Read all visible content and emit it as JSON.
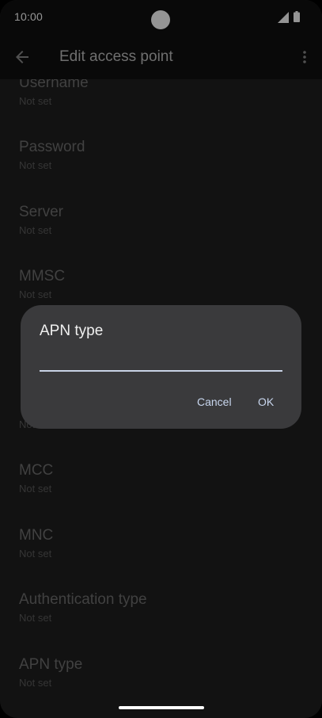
{
  "status_bar": {
    "time": "10:00",
    "icons": [
      "signal-icon",
      "battery-icon"
    ]
  },
  "app_bar": {
    "title": "Edit access point",
    "icons": [
      "back-arrow-icon",
      "overflow-menu-icon"
    ]
  },
  "preferences": [
    {
      "title": "Username",
      "summary": "Not set"
    },
    {
      "title": "Password",
      "summary": "Not set"
    },
    {
      "title": "Server",
      "summary": "Not set"
    },
    {
      "title": "MMSC",
      "summary": "Not set"
    },
    {
      "title": "",
      "summary": ""
    },
    {
      "title": "",
      "summary": "Not set"
    },
    {
      "title": "MCC",
      "summary": "Not set"
    },
    {
      "title": "MNC",
      "summary": "Not set"
    },
    {
      "title": "Authentication type",
      "summary": "Not set"
    },
    {
      "title": "APN type",
      "summary": "Not set"
    }
  ],
  "dialog": {
    "title": "APN type",
    "input_value": "",
    "cancel_label": "Cancel",
    "ok_label": "OK"
  },
  "colors": {
    "background": "#1f1f1f",
    "dialog": "#3a3a3c",
    "accent": "#c8d6ee"
  }
}
